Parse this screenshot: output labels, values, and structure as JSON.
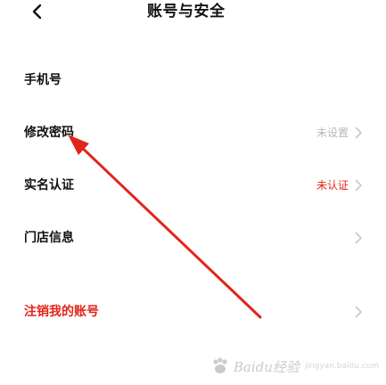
{
  "header": {
    "title": "账号与安全",
    "back_icon": "chevron-left-icon"
  },
  "settings": {
    "items": [
      {
        "label": "手机号",
        "value": "",
        "value_color": "",
        "label_color": "#111111",
        "has_chevron": false
      },
      {
        "label": "修改密码",
        "value": "未设置",
        "value_color": "#b8b8b8",
        "label_color": "#111111",
        "has_chevron": true
      },
      {
        "label": "实名认证",
        "value": "未认证",
        "value_color": "#e1251b",
        "label_color": "#111111",
        "has_chevron": true
      },
      {
        "label": "门店信息",
        "value": "",
        "value_color": "",
        "label_color": "#111111",
        "has_chevron": true
      },
      {
        "label": "注销我的账号",
        "value": "",
        "value_color": "",
        "label_color": "#e1251b",
        "has_chevron": true
      }
    ]
  },
  "annotation": {
    "color": "#e1251b"
  },
  "watermark": {
    "text": "Baidu经验",
    "sub": "jingyan.baidu.com"
  }
}
